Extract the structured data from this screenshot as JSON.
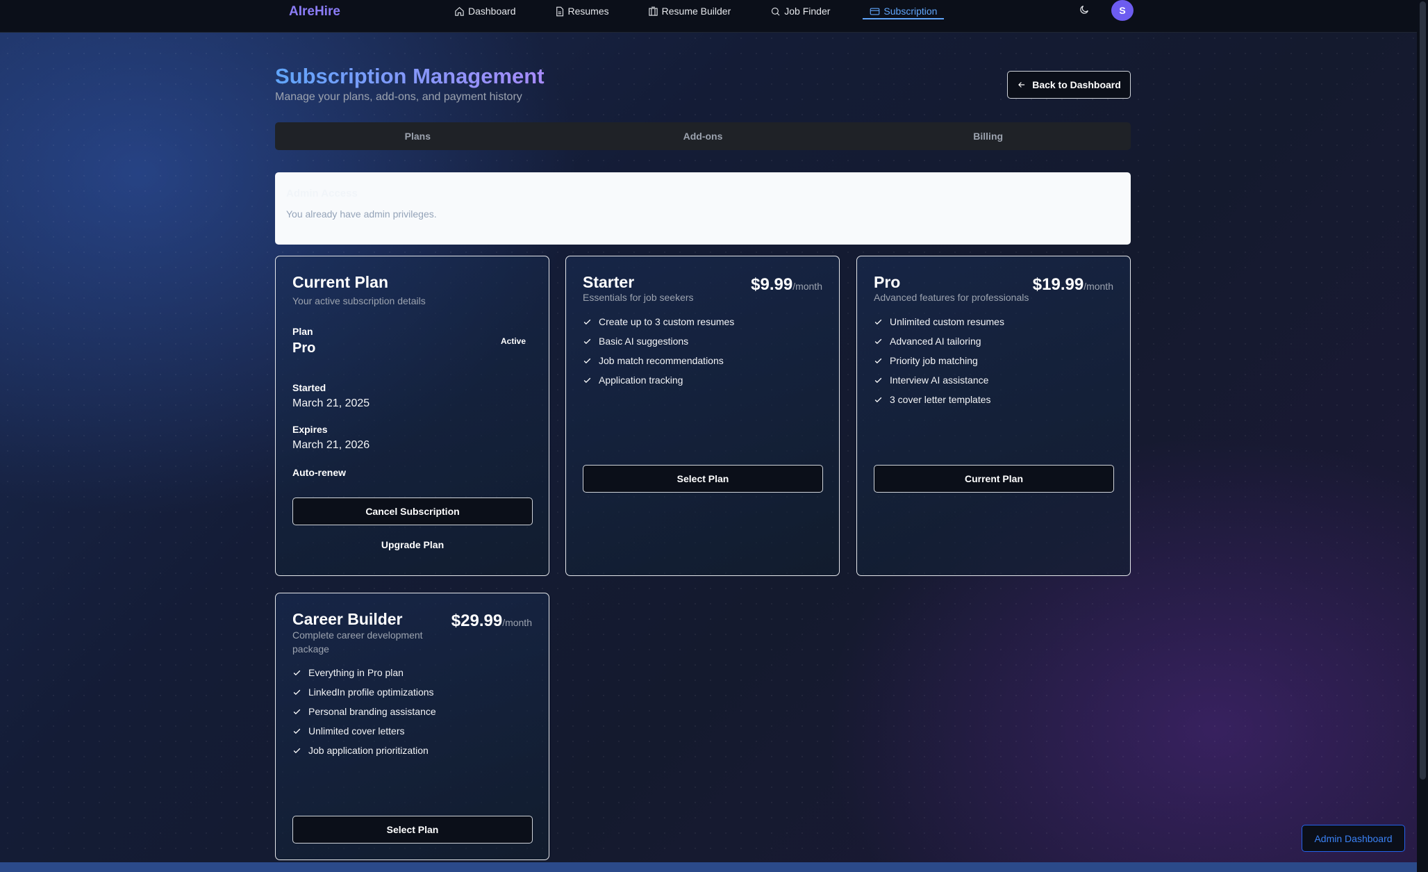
{
  "nav": {
    "brand": "AIreHire",
    "links": [
      {
        "label": "Dashboard",
        "icon": "home-icon"
      },
      {
        "label": "Resumes",
        "icon": "file-icon"
      },
      {
        "label": "Resume Builder",
        "icon": "builder-icon"
      },
      {
        "label": "Job Finder",
        "icon": "search-icon"
      },
      {
        "label": "Subscription",
        "icon": "card-icon",
        "active": true
      }
    ],
    "theme_icon": "moon-icon",
    "avatar_initial": "S"
  },
  "header": {
    "title": "Subscription Management",
    "subtitle": "Manage your plans, add-ons, and payment history",
    "back_label": "Back to Dashboard"
  },
  "tabs": [
    "Plans",
    "Add-ons",
    "Billing"
  ],
  "alert": {
    "title": "Admin Access",
    "text": "You already have admin privileges."
  },
  "current_plan": {
    "title": "Current Plan",
    "description": "Your active subscription details",
    "plan_label": "Plan",
    "plan_name": "Pro",
    "status": "Active",
    "started_label": "Started",
    "started_value": "March 21, 2025",
    "expires_label": "Expires",
    "expires_value": "March 21, 2026",
    "auto_renew_label": "Auto-renew",
    "cancel_label": "Cancel Subscription",
    "upgrade_label": "Upgrade Plan"
  },
  "plans": [
    {
      "name": "Starter",
      "description": "Essentials for job seekers",
      "price": "$9.99",
      "period": "/month",
      "features": [
        "Create up to 3 custom resumes",
        "Basic AI suggestions",
        "Job match recommendations",
        "Application tracking"
      ],
      "button": "Select Plan"
    },
    {
      "name": "Pro",
      "description": "Advanced features for professionals",
      "price": "$19.99",
      "period": "/month",
      "features": [
        "Unlimited custom resumes",
        "Advanced AI tailoring",
        "Priority job matching",
        "Interview AI assistance",
        "3 cover letter templates"
      ],
      "button": "Current Plan"
    },
    {
      "name": "Career Builder",
      "description": "Complete career development package",
      "price": "$29.99",
      "period": "/month",
      "features": [
        "Everything in Pro plan",
        "LinkedIn profile optimizations",
        "Personal branding assistance",
        "Unlimited cover letters",
        "Job application prioritization"
      ],
      "button": "Select Plan"
    }
  ],
  "admin_button": "Admin Dashboard",
  "colors": {
    "accent": "#60a5fa",
    "brand": "#8b7cf6",
    "avatar": "#6d5cf0",
    "admin": "#3b82f6"
  }
}
